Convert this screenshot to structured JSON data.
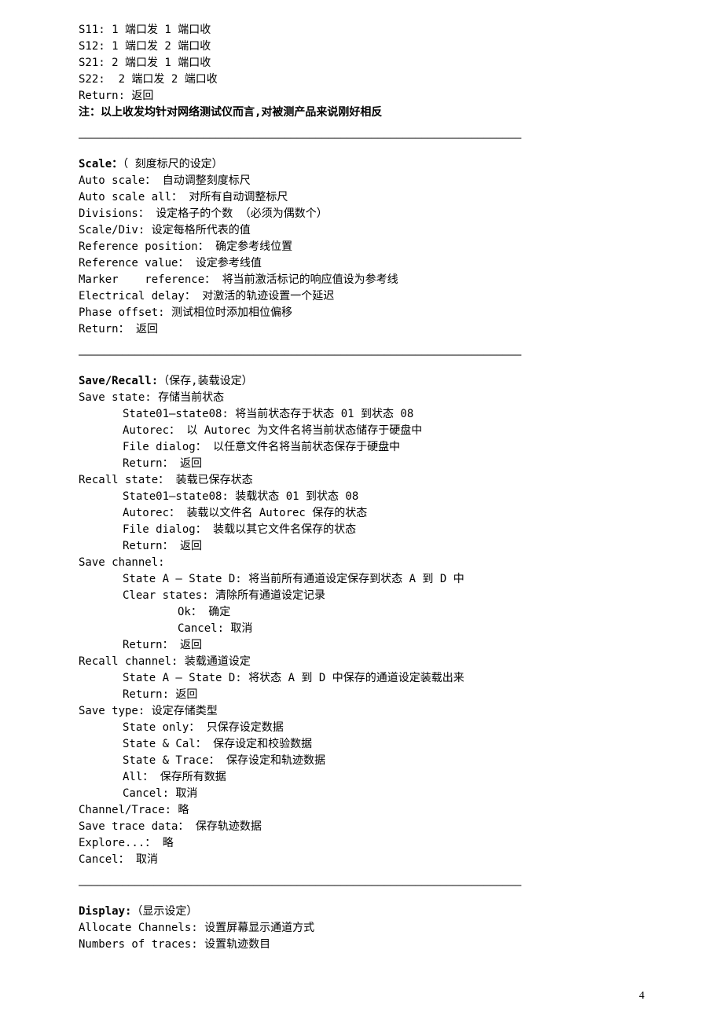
{
  "header": {
    "s11": "S11: 1 端口发 1 端口收",
    "s12": "S12: 1 端口发 2 端口收",
    "s21": "S21: 2 端口发 1 端口收",
    "s22": "S22:  2 端口发 2 端口收",
    "ret": "Return: 返回",
    "note": "注：以上收发均针对网络测试仪而言,对被测产品来说刚好相反"
  },
  "hr": "———————————————————————————————————————————————————————————————————————",
  "scale": {
    "title": "Scale：",
    "title_desc": "（ 刻度标尺的设定）",
    "auto_scale": "Auto scale： 自动调整刻度标尺",
    "auto_scale_all": "Auto scale all： 对所有自动调整标尺",
    "divisions": "Divisions： 设定格子的个数 （必须为偶数个）",
    "scale_div": "Scale/Div: 设定每格所代表的值",
    "ref_pos": "Reference position： 确定参考线位置",
    "ref_val": "Reference value： 设定参考线值",
    "marker_ref": "Marker    reference： 将当前激活标记的响应值设为参考线",
    "elec_delay": "Electrical delay： 对激活的轨迹设置一个延迟",
    "phase_offset": "Phase offset: 测试相位时添加相位偏移",
    "ret": "Return： 返回"
  },
  "save_recall": {
    "title": "Save/Recall:",
    "title_desc": "（保存,装载设定）",
    "save_state": "Save state: 存储当前状态",
    "ss_state01": "State01—state08: 将当前状态存于状态 01 到状态 08",
    "ss_autorec": "Autorec： 以 Autorec 为文件名将当前状态储存于硬盘中",
    "ss_file": "File dialog： 以任意文件名将当前状态保存于硬盘中",
    "ss_ret": "Return： 返回",
    "recall_state": "Recall state： 装载已保存状态",
    "rs_state01": "State01—state08: 装载状态 01 到状态 08",
    "rs_autorec": "Autorec： 装载以文件名 Autorec 保存的状态",
    "rs_file": "File dialog： 装载以其它文件名保存的状态",
    "rs_ret": "Return： 返回",
    "save_channel": "Save channel:",
    "sc_stateAD": "State A – State D: 将当前所有通道设定保存到状态 A 到 D 中",
    "sc_clear": "Clear states: 清除所有通道设定记录",
    "sc_ok": "Ok： 确定",
    "sc_cancel": "Cancel: 取消",
    "sc_ret": "Return： 返回",
    "recall_channel": "Recall channel: 装载通道设定",
    "rc_stateAD": "State A – State D: 将状态 A 到 D 中保存的通道设定装载出来",
    "rc_ret": "Return: 返回",
    "save_type": "Save type: 设定存储类型",
    "st_state_only": "State only： 只保存设定数据",
    "st_state_cal": "State & Cal： 保存设定和校验数据",
    "st_state_trace": "State & Trace： 保存设定和轨迹数据",
    "st_all": "All： 保存所有数据",
    "st_cancel": "Cancel: 取消",
    "channel_trace": "Channel/Trace: 略",
    "save_trace_data": "Save trace data： 保存轨迹数据",
    "explore": "Explore...： 略",
    "cancel": "Cancel： 取消"
  },
  "display": {
    "title": "Display:",
    "title_desc": "（显示设定）",
    "allocate": "Allocate Channels: 设置屏幕显示通道方式",
    "numbers": "Numbers of traces: 设置轨迹数目"
  },
  "page_number": "4"
}
